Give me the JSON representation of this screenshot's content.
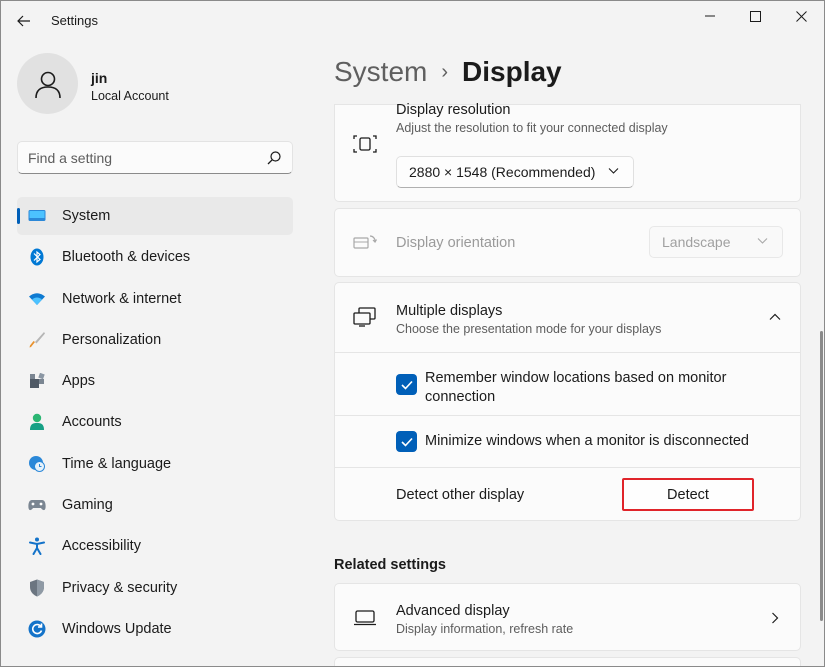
{
  "window": {
    "title": "Settings"
  },
  "user": {
    "name": "jin",
    "account_type": "Local Account"
  },
  "search": {
    "placeholder": "Find a setting"
  },
  "nav": {
    "items": [
      {
        "label": "System",
        "icon": "system-icon",
        "selected": true
      },
      {
        "label": "Bluetooth & devices",
        "icon": "bluetooth-icon"
      },
      {
        "label": "Network & internet",
        "icon": "wifi-icon"
      },
      {
        "label": "Personalization",
        "icon": "brush-icon"
      },
      {
        "label": "Apps",
        "icon": "apps-icon"
      },
      {
        "label": "Accounts",
        "icon": "person-icon"
      },
      {
        "label": "Time & language",
        "icon": "clock-globe-icon"
      },
      {
        "label": "Gaming",
        "icon": "gamepad-icon"
      },
      {
        "label": "Accessibility",
        "icon": "accessibility-icon"
      },
      {
        "label": "Privacy & security",
        "icon": "shield-icon"
      },
      {
        "label": "Windows Update",
        "icon": "update-icon"
      }
    ]
  },
  "breadcrumb": {
    "parent": "System",
    "separator": "›",
    "current": "Display"
  },
  "display_resolution": {
    "title": "Display resolution",
    "subtitle": "Adjust the resolution to fit your connected display",
    "value": "2880 × 1548 (Recommended)"
  },
  "display_orientation": {
    "title": "Display orientation",
    "value": "Landscape",
    "disabled": true
  },
  "multiple_displays": {
    "title": "Multiple displays",
    "subtitle": "Choose the presentation mode for your displays",
    "expanded": true,
    "options": [
      {
        "label": "Remember window locations based on monitor connection",
        "checked": true
      },
      {
        "label": "Minimize windows when a monitor is disconnected",
        "checked": true
      }
    ],
    "detect_label": "Detect other display",
    "detect_button": "Detect"
  },
  "related_settings": {
    "heading": "Related settings",
    "items": [
      {
        "title": "Advanced display",
        "subtitle": "Display information, refresh rate"
      }
    ]
  },
  "colors": {
    "accent": "#005fb8",
    "highlight_box": "#e0242a",
    "background": "#f3f3f3",
    "card": "#fbfbfb"
  }
}
